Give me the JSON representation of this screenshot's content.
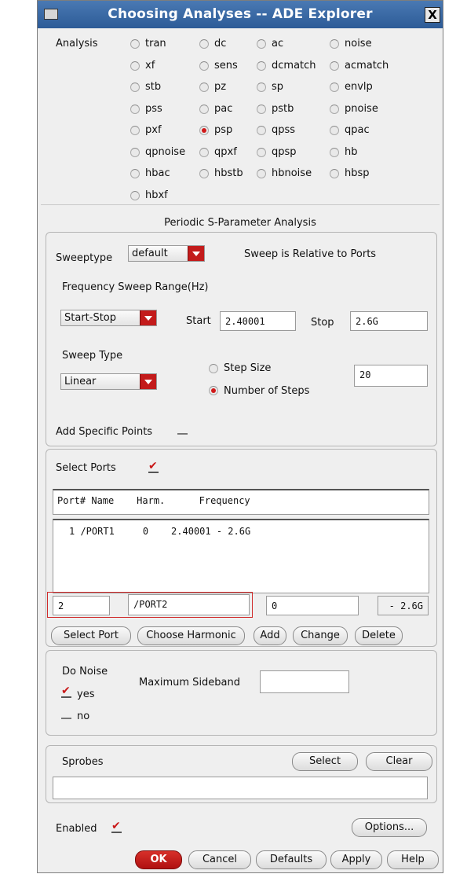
{
  "window": {
    "title": "Choosing Analyses -- ADE Explorer",
    "close_glyph": "X"
  },
  "analysis": {
    "label": "Analysis",
    "options": [
      "tran",
      "dc",
      "ac",
      "noise",
      "xf",
      "sens",
      "dcmatch",
      "acmatch",
      "stb",
      "pz",
      "sp",
      "envlp",
      "pss",
      "pac",
      "pstb",
      "pnoise",
      "pxf",
      "psp",
      "qpss",
      "qpac",
      "qpnoise",
      "qpxf",
      "qpsp",
      "hb",
      "hbac",
      "hbstb",
      "hbnoise",
      "hbsp",
      "hbxf"
    ],
    "selected": "psp"
  },
  "section_title": "Periodic S-Parameter Analysis",
  "sweep": {
    "sweeptype_label": "Sweeptype",
    "sweeptype_value": "default",
    "relative_note": "Sweep is Relative to Ports",
    "range_label": "Frequency Sweep Range(Hz)",
    "range_mode": "Start-Stop",
    "start_label": "Start",
    "start_value": "2.40001",
    "stop_label": "Stop",
    "stop_value": "2.6G",
    "type_label": "Sweep Type",
    "type_value": "Linear",
    "step_size_label": "Step Size",
    "num_steps_label": "Number of Steps",
    "num_steps_selected": true,
    "steps_value": "20",
    "add_points_label": "Add Specific Points",
    "add_points_checked": false
  },
  "ports": {
    "select_label": "Select Ports",
    "select_checked": true,
    "header": "Port# Name    Harm.      Frequency",
    "rows": [
      "1 /PORT1     0    2.40001 - 2.6G"
    ],
    "edit": {
      "num": "2",
      "name": "/PORT2",
      "harm": "0",
      "freq": "- 2.6G"
    },
    "buttons": {
      "select_port": "Select Port",
      "choose_harmonic": "Choose Harmonic",
      "add": "Add",
      "change": "Change",
      "delete": "Delete"
    }
  },
  "noise": {
    "do_label": "Do Noise",
    "yes": "yes",
    "yes_checked": true,
    "no": "no",
    "no_checked": false,
    "max_sideband_label": "Maximum Sideband",
    "max_sideband_value": ""
  },
  "sprobes": {
    "label": "Sprobes",
    "select": "Select",
    "clear": "Clear",
    "value": ""
  },
  "enabled": {
    "label": "Enabled",
    "checked": true
  },
  "buttons": {
    "options": "Options...",
    "ok": "OK",
    "cancel": "Cancel",
    "defaults": "Defaults",
    "apply": "Apply",
    "help": "Help"
  },
  "colors": {
    "title_bar": "#3a6aa6",
    "accent_red": "#c31b1b",
    "panel_bg": "#efefef"
  }
}
